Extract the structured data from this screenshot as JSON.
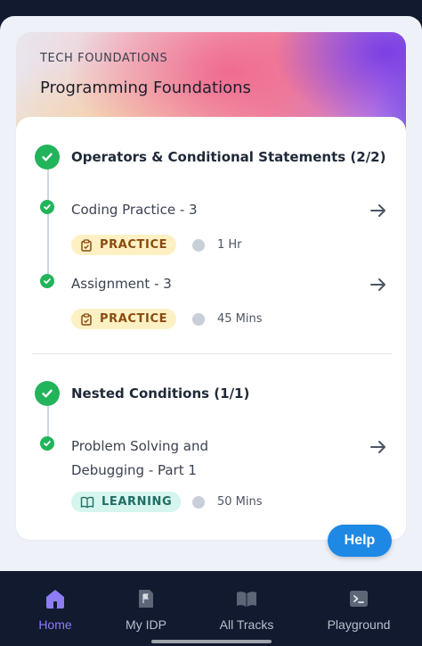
{
  "hero": {
    "eyebrow": "TECH FOUNDATIONS",
    "title": "Programming Foundations"
  },
  "sections": [
    {
      "title": "Operators & Conditional Statements (2/2)",
      "items": [
        {
          "title": "Coding Practice - 3",
          "badge": "PRACTICE",
          "badge_icon": "clipboard-icon",
          "duration": "1 Hr"
        },
        {
          "title": "Assignment - 3",
          "badge": "PRACTICE",
          "badge_icon": "clipboard-icon",
          "duration": "45 Mins"
        }
      ]
    },
    {
      "title": "Nested Conditions (1/1)",
      "items": [
        {
          "title_line1": "Problem Solving and",
          "title_line2": "Debugging - Part 1",
          "badge": "LEARNING",
          "badge_icon": "book-icon",
          "duration": "50 Mins"
        }
      ]
    }
  ],
  "help_label": "Help",
  "nav": {
    "items": [
      {
        "label": "Home",
        "icon": "home-icon",
        "active": true
      },
      {
        "label": "My IDP",
        "icon": "flag-doc-icon"
      },
      {
        "label": "All Tracks",
        "icon": "open-book-icon"
      },
      {
        "label": "Playground",
        "icon": "terminal-icon"
      }
    ]
  },
  "colors": {
    "success": "#22b45a",
    "accent_nav": "#8e7cf5",
    "help_button": "#1e88e5",
    "practice_bg": "#fdf1c4",
    "learning_bg": "#d5f5ee"
  }
}
